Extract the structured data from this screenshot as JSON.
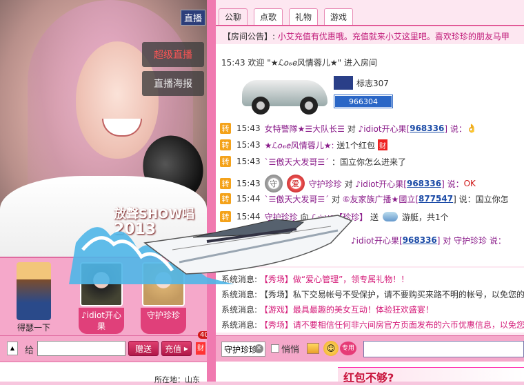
{
  "video": {
    "live_badge": "直播",
    "gift_button": "超级直播",
    "poster_button": "直播海报",
    "show_logo": "放聲SHOW唱",
    "show_year": "2013"
  },
  "queue": [
    {
      "name": "得瑟一下"
    },
    {
      "name": "♪idiot开心果"
    },
    {
      "name": "守护珍珍"
    }
  ],
  "gift_row": {
    "give_label": "给",
    "send_label": "赠送",
    "recharge_label": "充值",
    "gift_count": "40",
    "gift_icon": "财"
  },
  "location": "所在地：山东",
  "tabs": [
    "公聊",
    "点歌",
    "礼物",
    "游戏"
  ],
  "notice": {
    "label": "【房间公告】:",
    "text": "小艾充值有优惠哦。充值就来小艾这里吧。喜欢珍珍的朋友马甲"
  },
  "enter_line": "15:43 欢迎 \"★ℒ𝑜𝓋𝑒风情蓉儿★\" 进入房间",
  "car": {
    "name": "标志307",
    "number": "966304"
  },
  "messages": [
    {
      "zhuan": "转",
      "time": "15:43",
      "from": "女特警隊★☰大队长☰",
      "mid": "对",
      "to": "♪idiot开心果[",
      "uid": "968336",
      "end": "] 说：",
      "extra": "👌"
    },
    {
      "zhuan": "转",
      "time": "15:43",
      "from": "★ℒ𝑜𝓋𝑒风情蓉儿★:",
      "text": "送1个红包",
      "icon": "财"
    },
    {
      "zhuan": "转",
      "time": "15:43",
      "from": "ˋ☰傲天大发哥☰ˊ",
      "text": "：国立你怎么进来了"
    },
    {
      "zhuan": "转",
      "time": "15:43",
      "badge1": "守",
      "badge2": "爱",
      "from": "守护珍珍",
      "mid": "对",
      "to": "♪idiot开心果[",
      "uid": "968336",
      "end": "] 说：",
      "ok": "OK"
    },
    {
      "zhuan": "转",
      "time": "15:44",
      "from": "ˋ☰傲天大发哥☰ˊ",
      "mid": "对",
      "to": "⑥友家族广播★國立[",
      "uid": "877547",
      "end": "] 说：国立你怎"
    },
    {
      "zhuan": "转",
      "time": "15:44",
      "from": "守护珍珍",
      "mid": "向",
      "to": "ℒ☆ve【珍珍】",
      "text": "送",
      "text2": "游艇，共1个"
    },
    {
      "zhuan": "转",
      "time": "15:44",
      "from": "",
      "to": "♪idiot开心果[",
      "uid": "968336",
      "end": "] 对 守护珍珍 说："
    }
  ],
  "system": [
    {
      "label": "系统消息:",
      "hl": "【秀场】做“爱心管理”，领专属礼物！！",
      "text": ""
    },
    {
      "label": "系统消息:",
      "hl": "",
      "text": "【秀场】私下交易帐号不受保护，请不要购买来路不明的帐号，以免您的"
    },
    {
      "label": "系统消息:",
      "hl": "【游戏】最具最趣的美女互动！体验狂欢盛宴！",
      "text": ""
    },
    {
      "label": "系统消息:",
      "hl": "【秀场】请不要相信任何非六间房官方页面发布的六币优惠信息，以免您"
    }
  ],
  "chat_bar": {
    "target": "守护珍珍",
    "whisper_label": "悄悄",
    "vip": "专用"
  },
  "banner_text": "红包不够?",
  "colors": {
    "accent": "#e25a98",
    "nick": "#8a1c8a",
    "uid": "#1a4aa6",
    "system_highlight": "#d41a78"
  }
}
